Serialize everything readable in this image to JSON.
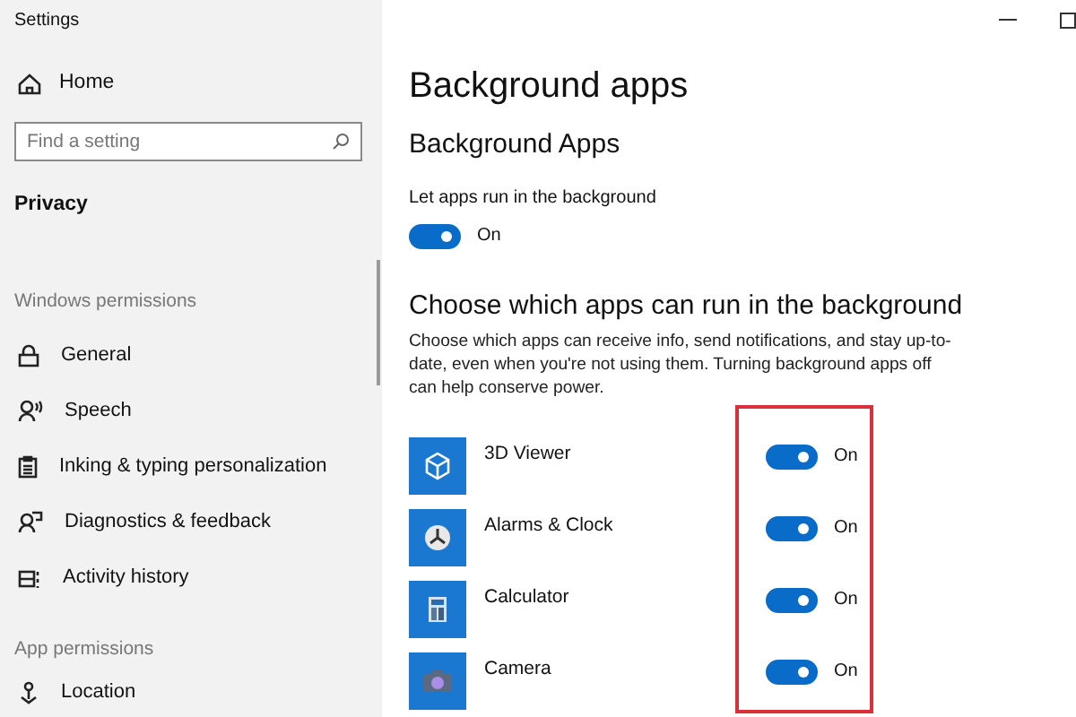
{
  "window": {
    "title": "Settings"
  },
  "sidebar": {
    "home": "Home",
    "search": {
      "placeholder": "Find a setting"
    },
    "section_title": "Privacy",
    "groups": [
      {
        "heading": "Windows permissions",
        "items": [
          {
            "label": "General"
          },
          {
            "label": "Speech"
          },
          {
            "label": "Inking & typing personalization"
          },
          {
            "label": "Diagnostics & feedback"
          },
          {
            "label": "Activity history"
          }
        ]
      },
      {
        "heading": "App permissions",
        "items": [
          {
            "label": "Location"
          }
        ]
      }
    ]
  },
  "main": {
    "title": "Background apps",
    "subtitle": "Background Apps",
    "master": {
      "label": "Let apps run in the background",
      "on": true,
      "state": "On"
    },
    "apps_heading": "Choose which apps can run in the background",
    "description": "Choose which apps can receive info, send notifications, and stay up-to-date, even when you're not using them. Turning background apps off can help conserve power.",
    "apps": [
      {
        "name": "3D Viewer",
        "on": true,
        "state": "On"
      },
      {
        "name": "Alarms & Clock",
        "on": true,
        "state": "On"
      },
      {
        "name": "Calculator",
        "on": true,
        "state": "On"
      },
      {
        "name": "Camera",
        "on": true,
        "state": "On"
      }
    ]
  }
}
